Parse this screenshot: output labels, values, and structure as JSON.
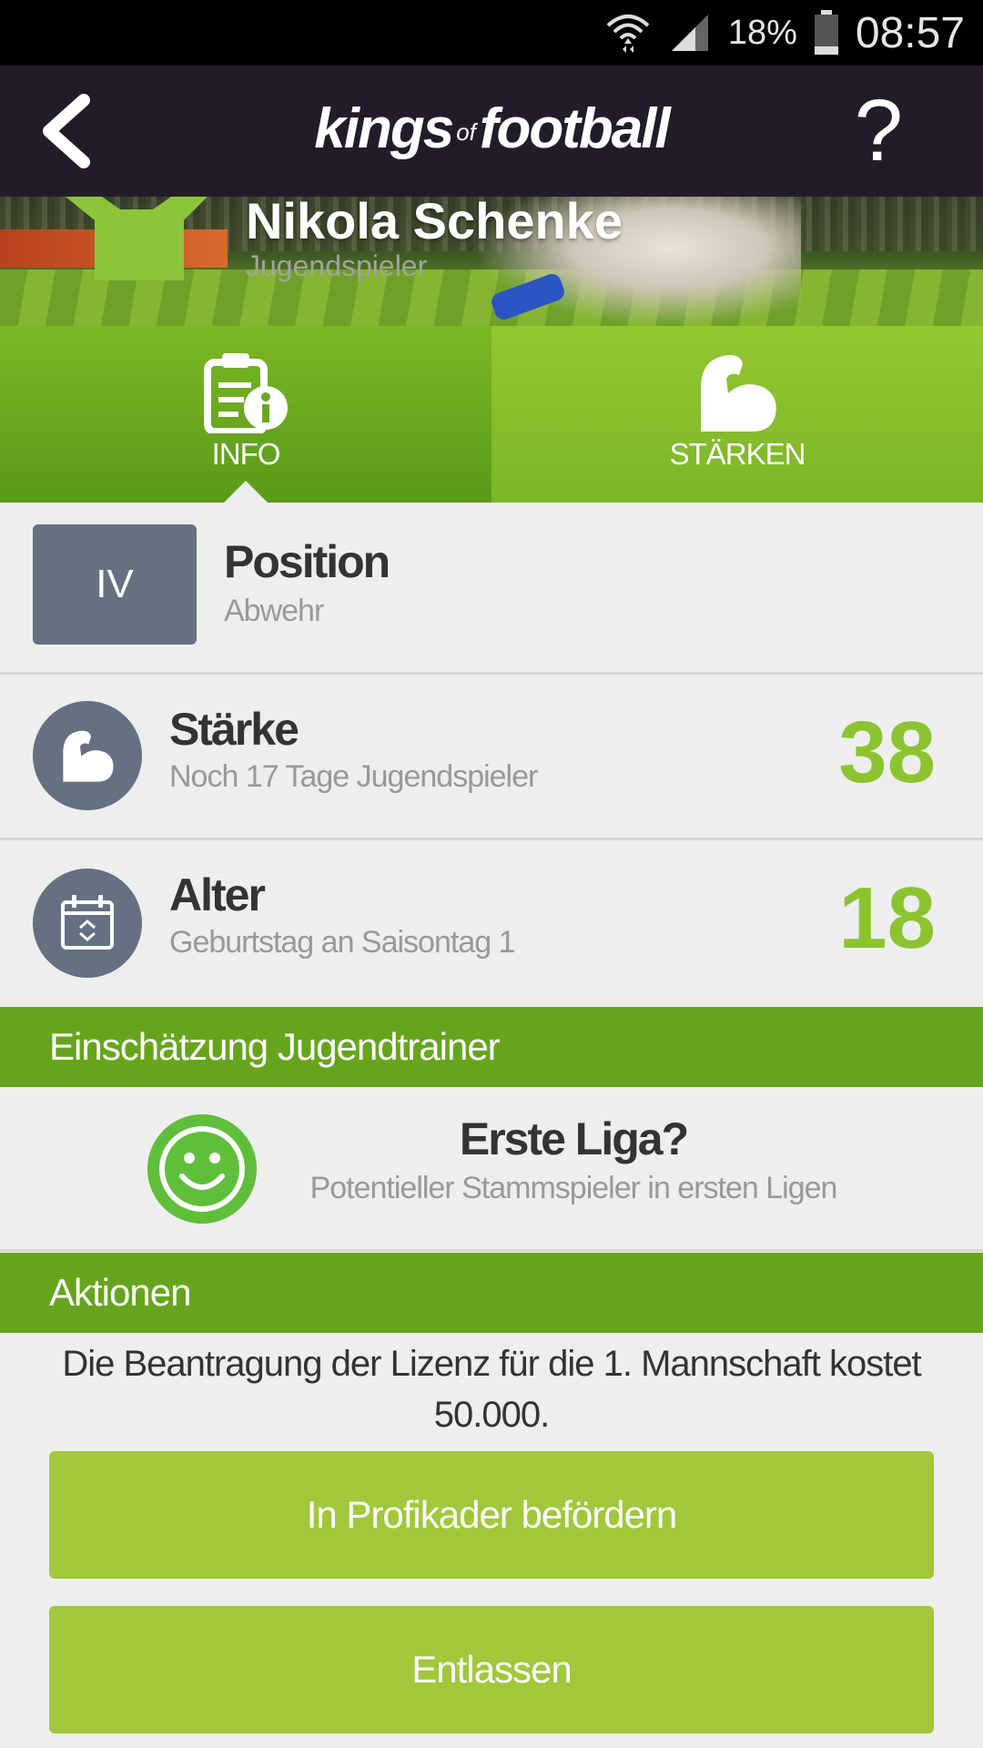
{
  "status_bar": {
    "battery": "18%",
    "time": "08:57"
  },
  "header": {
    "logo_kings": "kings",
    "logo_of": "of",
    "logo_football": "football",
    "help": "?"
  },
  "player": {
    "name": "Nikola Schenke",
    "role": "Jugendspieler"
  },
  "tabs": [
    {
      "label": "INFO",
      "icon": "info-document-icon",
      "selected": true
    },
    {
      "label": "STÄRKEN",
      "icon": "flexed-arm-icon",
      "selected": false
    }
  ],
  "position": {
    "badge": "IV",
    "title": "Position",
    "subtitle": "Abwehr"
  },
  "strength": {
    "title": "Stärke",
    "subtitle": "Noch 17 Tage Jugendspieler",
    "value": "38"
  },
  "age": {
    "title": "Alter",
    "subtitle": "Geburtstag an Saisontag 1",
    "value": "18"
  },
  "assessment": {
    "header": "Einschätzung Jugendtrainer",
    "title": "Erste Liga?",
    "subtitle": "Potentieller Stammspieler in ersten Ligen"
  },
  "actions": {
    "header": "Aktionen",
    "license_text": "Die Beantragung der Lizenz für die 1. Mannschaft kostet 50.000.",
    "promote_label": "In Profikader befördern",
    "dismiss_label": "Entlassen"
  },
  "colors": {
    "nav_bg": "#221c2a",
    "accent_green": "#8cc430",
    "section_green": "#66a51b",
    "button_green": "#a0c83a",
    "badge_gray": "#657082"
  }
}
